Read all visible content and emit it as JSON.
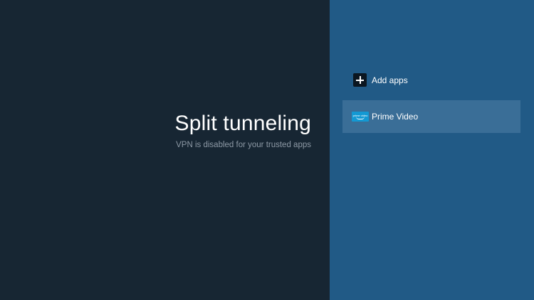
{
  "header": {
    "title": "Split tunneling",
    "subtitle": "VPN is disabled for your trusted apps"
  },
  "menu": {
    "add_apps_label": "Add apps",
    "apps": [
      {
        "label": "Prime Video",
        "icon": "prime-video-icon",
        "icon_text": "prime video",
        "selected": true
      }
    ]
  },
  "colors": {
    "left_background": "#172633",
    "right_background": "#215a86",
    "selected_item": "#3a6e97",
    "prime_blue": "#1399d3"
  }
}
